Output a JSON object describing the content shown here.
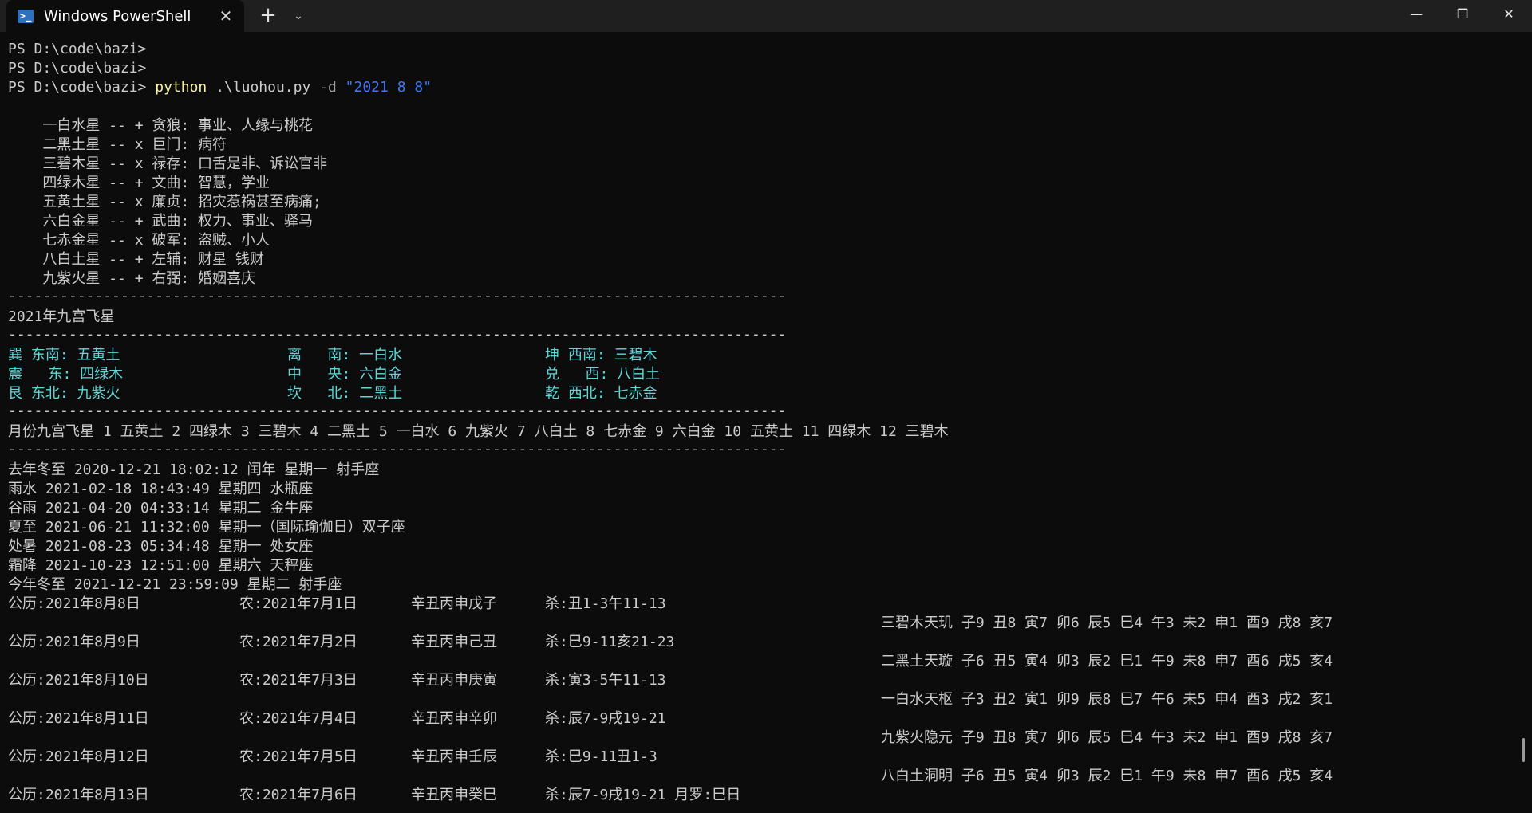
{
  "window": {
    "tab_title": "Windows PowerShell",
    "tab_close": "✕",
    "new_tab": "+",
    "dropdown": "⌄",
    "minimize": "—",
    "maximize": "❐",
    "close": "✕"
  },
  "terminal": {
    "prompts": [
      "PS D:\\code\\bazi>",
      "PS D:\\code\\bazi>",
      "PS D:\\code\\bazi> "
    ],
    "command": {
      "exe": "python",
      "args": " .\\luohou.py ",
      "flag": "-d ",
      "value": "\"2021 8 8\""
    },
    "stars": [
      "    一白水星 -- + 贪狼: 事业、人缘与桃花",
      "    二黑土星 -- x 巨门: 病符",
      "    三碧木星 -- x 禄存: 口舌是非、诉讼官非",
      "    四绿木星 -- + 文曲: 智慧，学业",
      "    五黄土星 -- x 廉贞: 招灾惹祸甚至病痛;",
      "    六白金星 -- + 武曲: 权力、事业、驿马",
      "    七赤金星 -- x 破军: 盗贼、小人",
      "    八白土星 -- + 左辅: 财星 钱财",
      "    九紫火星 -- + 右弼: 婚姻喜庆"
    ],
    "divider": "------------------------------------------------------------------------------------------",
    "year_title": "2021年九宫飞星",
    "palaces": [
      [
        "巽 东南: 五黄土",
        "离   南: 一白水",
        "坤 西南: 三碧木"
      ],
      [
        "震   东: 四绿木",
        "中   央: 六白金",
        "兑   西: 八白土"
      ],
      [
        "艮 东北: 九紫火",
        "坎   北: 二黑土",
        "乾 西北: 七赤金"
      ]
    ],
    "monthly": "月份九宫飞星 1 五黄土 2 四绿木 3 三碧木 4 二黑土 5 一白水 6 九紫火 7 八白土 8 七赤金 9 六白金 10 五黄土 11 四绿木 12 三碧木",
    "solar_terms": [
      "去年冬至 2020-12-21 18:02:12 闰年 星期一 射手座",
      "雨水 2021-02-18 18:43:49 星期四 水瓶座",
      "谷雨 2021-04-20 04:33:14 星期二 金牛座",
      "夏至 2021-06-21 11:32:00 星期一（国际瑜伽日）双子座",
      "处暑 2021-08-23 05:34:48 星期一 处女座",
      "霜降 2021-10-23 12:51:00 星期六 天秤座",
      "今年冬至 2021-12-21 23:59:09 星期二 射手座"
    ],
    "days": [
      {
        "solar": "公历:2021年8月8日",
        "lunar": "农:2021年7月1日",
        "ganzhi": "辛丑丙申戊子",
        "sha": "杀:丑1-3午11-13"
      },
      {
        "solar": "公历:2021年8月9日",
        "lunar": "农:2021年7月2日",
        "ganzhi": "辛丑丙申己丑",
        "sha": "杀:巳9-11亥21-23"
      },
      {
        "solar": "公历:2021年8月10日",
        "lunar": "农:2021年7月3日",
        "ganzhi": "辛丑丙申庚寅",
        "sha": "杀:寅3-5午11-13"
      },
      {
        "solar": "公历:2021年8月11日",
        "lunar": "农:2021年7月4日",
        "ganzhi": "辛丑丙申辛卯",
        "sha": "杀:辰7-9戌19-21"
      },
      {
        "solar": "公历:2021年8月12日",
        "lunar": "农:2021年7月5日",
        "ganzhi": "辛丑丙申壬辰",
        "sha": "杀:巳9-11丑1-3"
      },
      {
        "solar": "公历:2021年8月13日",
        "lunar": "农:2021年7月6日",
        "ganzhi": "辛丑丙申癸巳",
        "sha": "杀:辰7-9戌19-21 月罗:巳日"
      }
    ],
    "right_stars": [
      "三碧木天玑 子9 丑8 寅7 卯6 辰5 巳4 午3 未2 申1 酉9 戌8 亥7",
      "二黑土天璇 子6 丑5 寅4 卯3 辰2 巳1 午9 未8 申7 酉6 戌5 亥4",
      "一白水天枢 子3 丑2 寅1 卯9 辰8 巳7 午6 未5 申4 酉3 戌2 亥1",
      "九紫火隐元 子9 丑8 寅7 卯6 辰5 巳4 午3 未2 申1 酉9 戌8 亥7",
      "八白土洞明 子6 丑5 寅4 卯3 辰2 巳1 午9 未8 申7 酉6 戌5 亥4"
    ]
  },
  "colors": {
    "background": "#0c0c0c",
    "text": "#cccccc",
    "cyan": "#61d6d6",
    "yellow": "#f9f1a5",
    "blue": "#3b78ff"
  }
}
